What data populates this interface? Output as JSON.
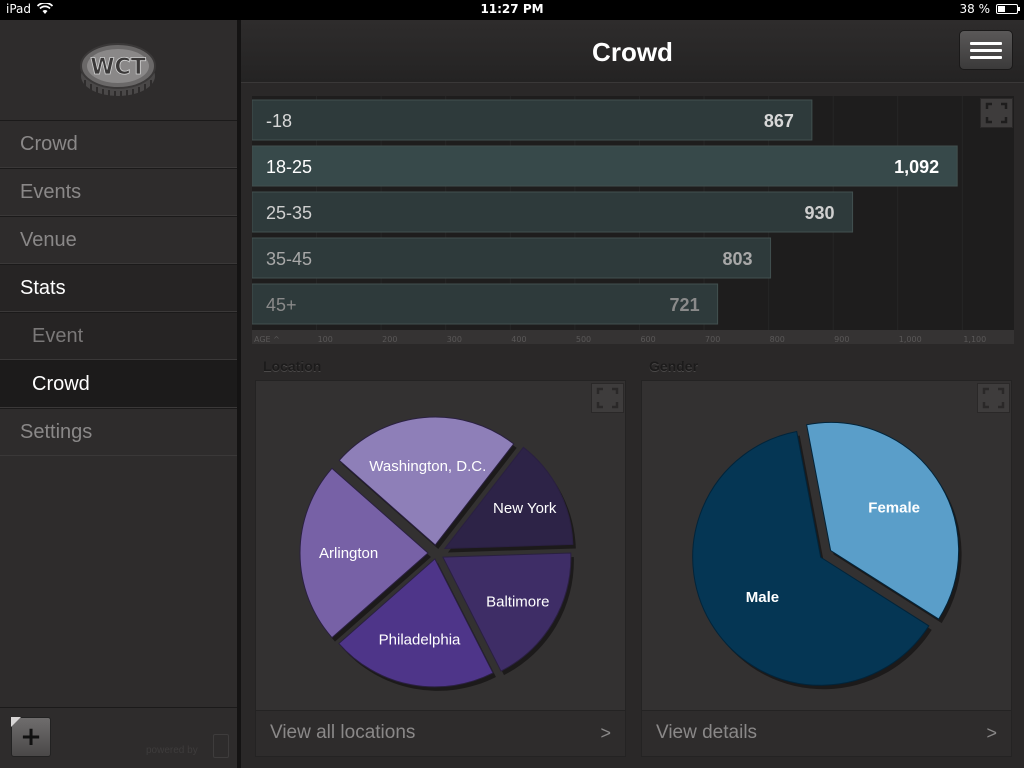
{
  "status_bar": {
    "device": "iPad",
    "time": "11:27 PM",
    "battery_text": "38 %",
    "battery_level": 0.38
  },
  "sidebar": {
    "logo_text": "WCT",
    "items": [
      {
        "label": "Crowd"
      },
      {
        "label": "Events"
      },
      {
        "label": "Venue"
      },
      {
        "label": "Stats"
      },
      {
        "label": "Event"
      },
      {
        "label": "Crowd"
      },
      {
        "label": "Settings"
      }
    ],
    "add_label": "+",
    "powered_by": "powered by"
  },
  "header": {
    "title": "Crowd"
  },
  "age_chart": {
    "chart_data": {
      "type": "bar",
      "orientation": "horizontal",
      "categories": [
        "-18",
        "18-25",
        "25-35",
        "35-45",
        "45+"
      ],
      "values": [
        867,
        1092,
        930,
        803,
        721
      ],
      "value_labels": [
        "867",
        "1,092",
        "930",
        "803",
        "721"
      ],
      "x_axis_label": "AGE",
      "x_ticks": [
        "100",
        "200",
        "300",
        "400",
        "500",
        "600",
        "700",
        "800",
        "900",
        "1,000",
        "1,100"
      ],
      "xlim": [
        0,
        1180
      ]
    },
    "colors": {
      "bar": "#2e3a3b",
      "bar_highlight": "#37494a",
      "label": "#d0d0d0"
    }
  },
  "location": {
    "title": "Location",
    "chart_data": {
      "type": "pie",
      "labels": [
        "Washington, D.C.",
        "New York",
        "Baltimore",
        "Philadelphia",
        "Arlington"
      ],
      "values": [
        24,
        14,
        18,
        21,
        23
      ],
      "colors": [
        "#8e7fb8",
        "#2d2347",
        "#3e2d66",
        "#4e3589",
        "#7761a6"
      ]
    },
    "footer_link": "View all locations",
    "chevron": ">"
  },
  "gender": {
    "title": "Gender",
    "chart_data": {
      "type": "pie",
      "labels": [
        "Female",
        "Male"
      ],
      "values": [
        37,
        63
      ],
      "colors": [
        "#5a9ec9",
        "#053654"
      ]
    },
    "footer_link": "View details",
    "chevron": ">"
  }
}
